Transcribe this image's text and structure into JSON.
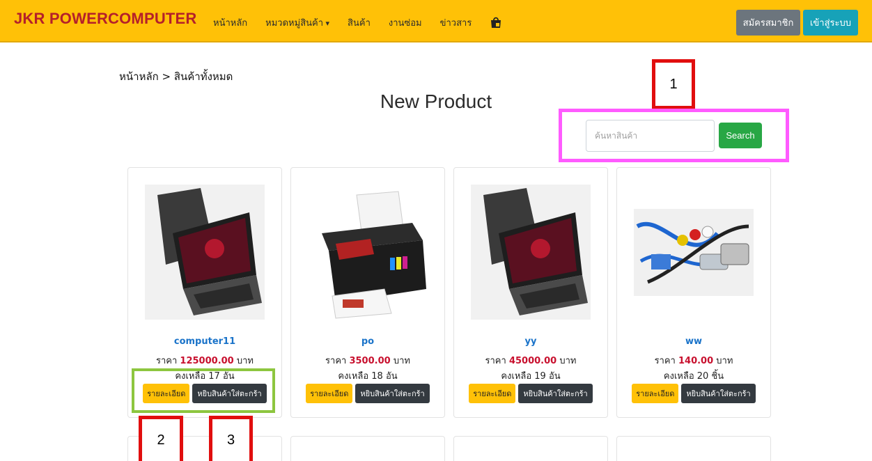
{
  "navbar": {
    "brand": "JKR POWERCOMPUTER",
    "items": [
      {
        "label": "หน้าหลัก"
      },
      {
        "label": "หมวดหมู่สินค้า"
      },
      {
        "label": "สินค้า"
      },
      {
        "label": "งานซ่อม"
      },
      {
        "label": "ข่าวสาร"
      }
    ],
    "cart_icon": "shopping-bag-icon",
    "register_label": "สมัครสมาชิก",
    "login_label": "เข้าสู่ระบบ",
    "color": "#ffc107"
  },
  "breadcrumb": "หน้าหลัก > สินค้าทั้งหมด",
  "page_title": "New Product",
  "search": {
    "placeholder": "ค้นหาสินค้า",
    "button_label": "Search"
  },
  "annotations": [
    "1",
    "2",
    "3"
  ],
  "products": [
    {
      "name": "computer11",
      "price_prefix": "ราคา",
      "price": "125000.00",
      "price_unit": "บาท",
      "stock": "คงเหลือ 17 อัน",
      "image": "laptop",
      "detail_label": "รายละเอียด",
      "cart_label": "หยิบสินค้าใส่ตะกร้า"
    },
    {
      "name": "po",
      "price_prefix": "ราคา",
      "price": "3500.00",
      "price_unit": "บาท",
      "stock": "คงเหลือ 18 อัน",
      "image": "printer",
      "detail_label": "รายละเอียด",
      "cart_label": "หยิบสินค้าใส่ตะกร้า"
    },
    {
      "name": "yy",
      "price_prefix": "ราคา",
      "price": "45000.00",
      "price_unit": "บาท",
      "stock": "คงเหลือ 19 อัน",
      "image": "laptop",
      "detail_label": "รายละเอียด",
      "cart_label": "หยิบสินค้าใส่ตะกร้า"
    },
    {
      "name": "ww",
      "price_prefix": "ราคา",
      "price": "140.00",
      "price_unit": "บาท",
      "stock": "คงเหลือ 20 ชิ้น",
      "image": "cables",
      "detail_label": "รายละเอียด",
      "cart_label": "หยิบสินค้าใส่ตะกร้า"
    }
  ]
}
